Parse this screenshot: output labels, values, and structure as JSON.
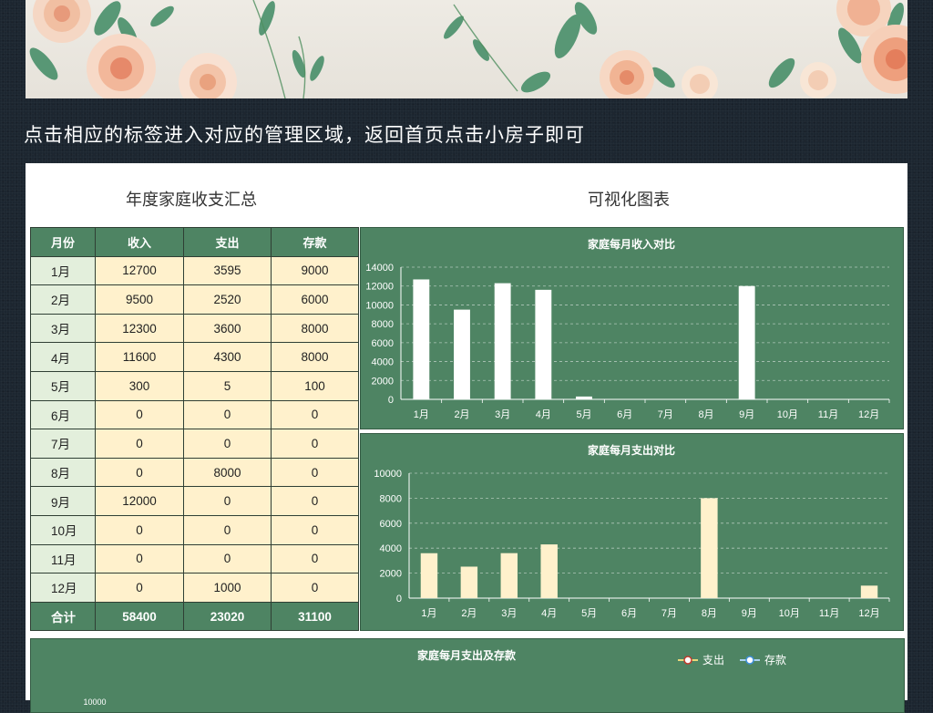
{
  "instruction": "点击相应的标签进入对应的管理区域，返回首页点击小房子即可",
  "table_title": "年度家庭收支汇总",
  "chart_section_title": "可视化图表",
  "table": {
    "headers": [
      "月份",
      "收入",
      "支出",
      "存款"
    ],
    "rows": [
      [
        "1月",
        "12700",
        "3595",
        "9000"
      ],
      [
        "2月",
        "9500",
        "2520",
        "6000"
      ],
      [
        "3月",
        "12300",
        "3600",
        "8000"
      ],
      [
        "4月",
        "11600",
        "4300",
        "8000"
      ],
      [
        "5月",
        "300",
        "5",
        "100"
      ],
      [
        "6月",
        "0",
        "0",
        "0"
      ],
      [
        "7月",
        "0",
        "0",
        "0"
      ],
      [
        "8月",
        "0",
        "8000",
        "0"
      ],
      [
        "9月",
        "12000",
        "0",
        "0"
      ],
      [
        "10月",
        "0",
        "0",
        "0"
      ],
      [
        "11月",
        "0",
        "0",
        "0"
      ],
      [
        "12月",
        "0",
        "1000",
        "0"
      ]
    ],
    "total": [
      "合计",
      "58400",
      "23020",
      "31100"
    ]
  },
  "colors": {
    "panel_green": "#4e8463",
    "income_bar": "#ffffff",
    "expense_bar": "#fff1cc",
    "month_cell": "#e3efdc",
    "value_cell": "#fff1cc",
    "legend_expense_marker": "#c0392b",
    "legend_saving_marker": "#3d8fd8"
  },
  "chart_data": [
    {
      "type": "bar",
      "title": "家庭每月收入对比",
      "categories": [
        "1月",
        "2月",
        "3月",
        "4月",
        "5月",
        "6月",
        "7月",
        "8月",
        "9月",
        "10月",
        "11月",
        "12月"
      ],
      "values": [
        12700,
        9500,
        12300,
        11600,
        300,
        0,
        0,
        0,
        12000,
        0,
        0,
        0
      ],
      "ylim": [
        0,
        14000
      ],
      "yticks": [
        "14000",
        "12000",
        "10000",
        "8000",
        "6000",
        "4000",
        "2000",
        "0"
      ],
      "grid": true
    },
    {
      "type": "bar",
      "title": "家庭每月支出对比",
      "categories": [
        "1月",
        "2月",
        "3月",
        "4月",
        "5月",
        "6月",
        "7月",
        "8月",
        "9月",
        "10月",
        "11月",
        "12月"
      ],
      "values": [
        3595,
        2520,
        3600,
        4300,
        5,
        0,
        0,
        8000,
        0,
        0,
        0,
        1000
      ],
      "ylim": [
        0,
        10000
      ],
      "yticks": [
        "10000",
        "8000",
        "6000",
        "4000",
        "2000",
        "0"
      ],
      "grid": true
    },
    {
      "type": "line",
      "title": "家庭每月支出及存款",
      "legend": [
        "支出",
        "存款"
      ],
      "legend_position": "top-right",
      "visible_tick": "10000"
    }
  ]
}
